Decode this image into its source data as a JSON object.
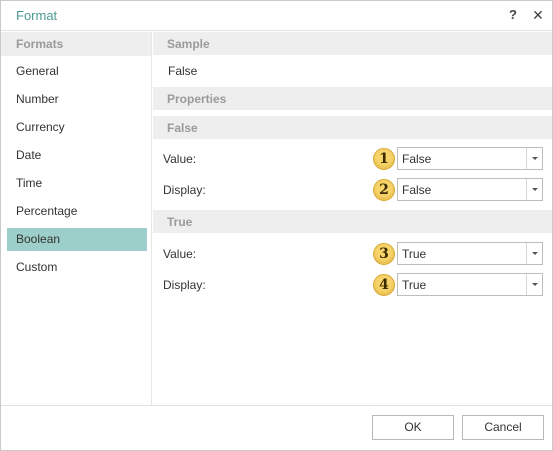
{
  "dialog": {
    "title": "Format",
    "help_label": "?",
    "close_label": "✕"
  },
  "sidebar": {
    "header": "Formats",
    "items": [
      {
        "label": "General"
      },
      {
        "label": "Number"
      },
      {
        "label": "Currency"
      },
      {
        "label": "Date"
      },
      {
        "label": "Time"
      },
      {
        "label": "Percentage"
      },
      {
        "label": "Boolean",
        "selected": true
      },
      {
        "label": "Custom"
      }
    ]
  },
  "main": {
    "sample_header": "Sample",
    "sample_value": "False",
    "properties_header": "Properties",
    "false_section": {
      "header": "False",
      "value_label": "Value:",
      "value_badge": "1",
      "value_selected": "False",
      "display_label": "Display:",
      "display_badge": "2",
      "display_selected": "False"
    },
    "true_section": {
      "header": "True",
      "value_label": "Value:",
      "value_badge": "3",
      "value_selected": "True",
      "display_label": "Display:",
      "display_badge": "4",
      "display_selected": "True"
    }
  },
  "footer": {
    "ok_label": "OK",
    "cancel_label": "Cancel"
  },
  "colors": {
    "accent_title": "#4a9a94",
    "selected_item_bg": "#9ccfc9",
    "section_bg": "#eeeeee",
    "badge_fill": "#f7d46a"
  }
}
